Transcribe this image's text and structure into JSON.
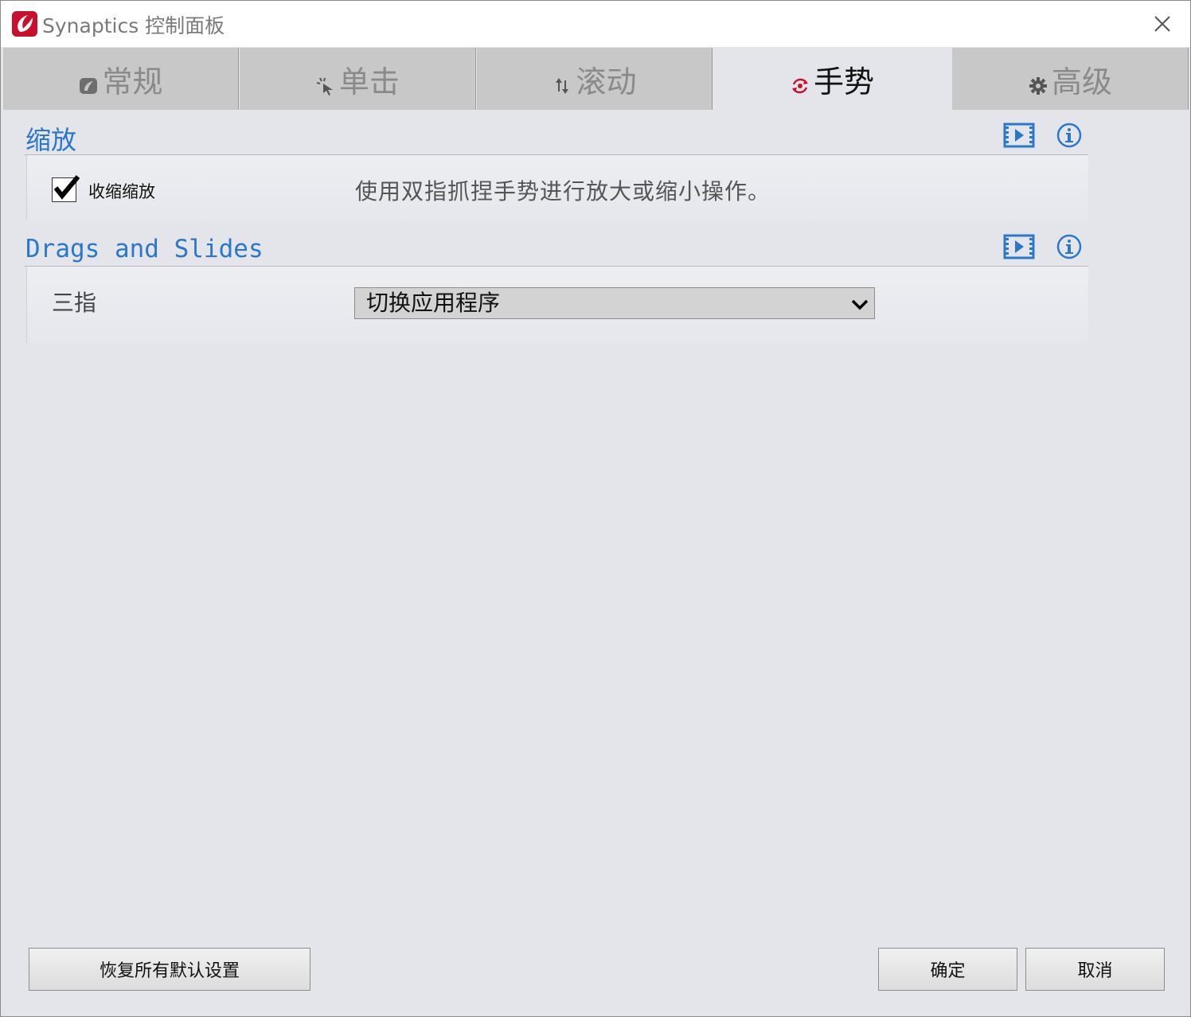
{
  "window": {
    "title": "Synaptics 控制面板"
  },
  "tabs": [
    {
      "label": "常规",
      "icon": "leaf-icon",
      "active": false
    },
    {
      "label": "单击",
      "icon": "click-icon",
      "active": false
    },
    {
      "label": "滚动",
      "icon": "scroll-arrows-icon",
      "active": false
    },
    {
      "label": "手势",
      "icon": "gesture-icon",
      "active": true
    },
    {
      "label": "高级",
      "icon": "gear-icon",
      "active": false
    }
  ],
  "zoom_section": {
    "title": "缩放",
    "checkbox_label": "收缩缩放",
    "checkbox_checked": true,
    "description": "使用双指抓捏手势进行放大或缩小操作。"
  },
  "drags_section": {
    "title": "Drags and Slides",
    "row_label": "三指",
    "select_value": "切换应用程序"
  },
  "footer": {
    "restore_label": "恢复所有默认设置",
    "ok_label": "确定",
    "cancel_label": "取消"
  },
  "colors": {
    "accent_blue": "#2a78c8",
    "brand_red": "#c8102e",
    "active_tab_icon": "#c8102e"
  }
}
